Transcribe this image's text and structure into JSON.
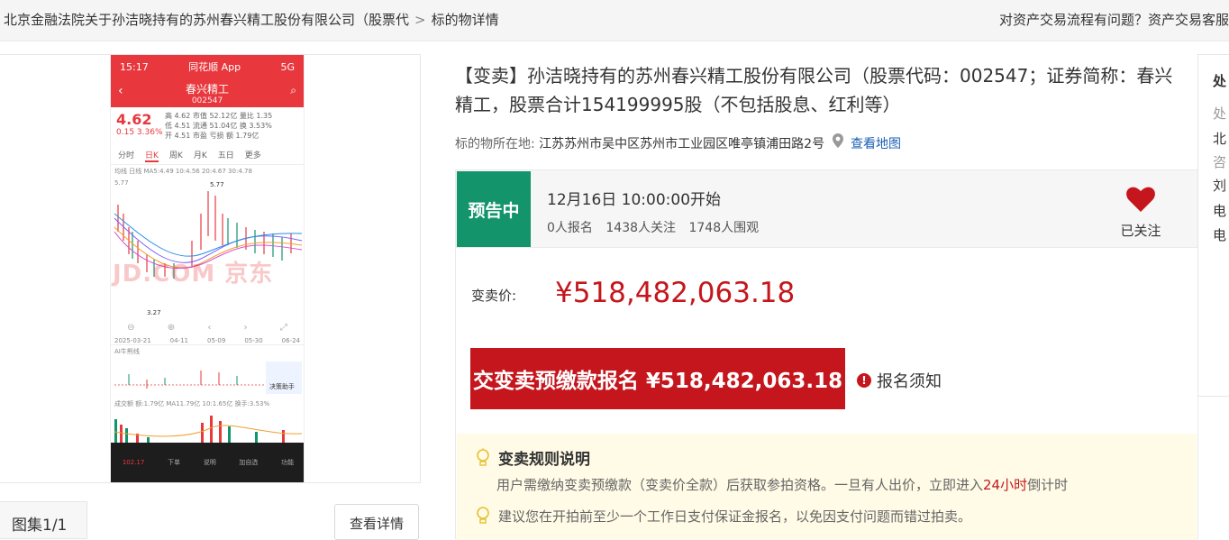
{
  "breadcrumb": {
    "parent": "北京金融法院关于孙洁晓持有的苏州春兴精工股份有限公司（股票代",
    "separator": ">",
    "current": "标的物详情"
  },
  "help_link": "对资产交易流程有问题？资产交易客服",
  "gallery": {
    "album_label": "图集1/1",
    "detail_button": "查看详情",
    "screenshot": {
      "status_time": "15:17",
      "status_app": "同花顺 App",
      "status_net": "5G",
      "stock_name": "春兴精工",
      "stock_code": "002547",
      "price": "4.62",
      "change": "0.15",
      "change_pct": "3.36%",
      "stats": [
        "高 4.62  市值 52.12亿  量比 1.35",
        "低 4.51  流通 51.04亿  换 3.53%",
        "开 4.51  市盈 亏损  额 1.79亿"
      ],
      "tabs": [
        "分时",
        "日K",
        "周K",
        "月K",
        "五日",
        "更多"
      ],
      "ma_legend": "均线 日线 MA5:4.49  10:4.56  20:4.67  30:4.78",
      "high_label": "5.77",
      "low_label": "3.27",
      "dates": [
        "2025-03-21",
        "04-11",
        "05-09",
        "05-30",
        "06-24"
      ],
      "sub_legend": "AI牛熊线",
      "assistant": "决策助手",
      "vol_legend": "成交额  额:1.79亿  MA11.79亿  10:1.65亿  换手:3.53%",
      "watermark": "JD.COM 京东",
      "footer": [
        "102.17",
        "下单",
        "说明",
        "加自选",
        "功能"
      ]
    }
  },
  "item": {
    "title": "【变卖】孙洁晓持有的苏州春兴精工股份有限公司（股票代码：002547；证券简称：春兴精工，股票合计154199995股（不包括股息、红利等）",
    "location_label": "标的物所在地:",
    "location": "江苏苏州市吴中区苏州市工业园区唯亭镇浦田路2号",
    "map_link": "查看地图"
  },
  "status": {
    "badge": "预告中",
    "start_time": "12月16日 10:00:00开始",
    "signups": "0人报名",
    "followers": "1438人关注",
    "viewers": "1748人围观",
    "follow_label": "已关注"
  },
  "price": {
    "label": "变卖价:",
    "value": "¥518,482,063.18"
  },
  "signup": {
    "button": "交变卖预缴款报名 ¥518,482,063.18",
    "notice": "报名须知"
  },
  "rules": {
    "title": "变卖规则说明",
    "text_before": "用户需缴纳变卖预缴款（变卖价全款）后获取参拍资格。一旦有人出价，立即进入",
    "text_highlight": "24小时",
    "text_after": "倒计时",
    "tip": "建议您在开拍前至少一个工作日支付保证金报名，以免因支付问题而错过拍卖。"
  },
  "contact": {
    "lines": [
      "处",
      "处",
      "北",
      "咨",
      "刘",
      "电",
      "电"
    ]
  },
  "colors": {
    "accent_red": "#c4161c",
    "status_green": "#13946b",
    "rules_bg": "#fffbe6",
    "link_blue": "#1a5fb4"
  }
}
